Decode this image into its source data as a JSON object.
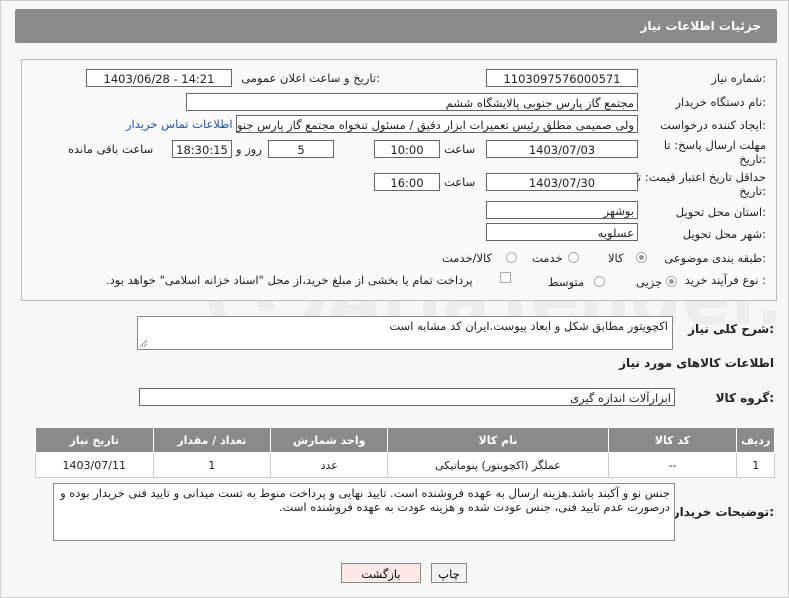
{
  "header": {
    "title": "جزئیات اطلاعات نیاز"
  },
  "form": {
    "need_number_label": "شماره نیاز:",
    "need_number": "1103097576000571",
    "announce_label": "تاریخ و ساعت اعلان عمومی:",
    "announce_value": "1403/06/28 - 14:21",
    "buyer_org_label": "نام دستگاه خریدار:",
    "buyer_org": "مجتمع گاز پارس جنوبی  پالایشگاه ششم",
    "requester_label": "ایجاد کننده درخواست:",
    "requester": "ولی صمیمی مطلق رئیس تعمیرات ابزار دقیق / مسئول تنخواه مجتمع گاز پارس جنوبی",
    "contact_link": "اطلاعات تماس خریدار",
    "deadline_label_1": "مهلت ارسال پاسخ: تا",
    "deadline_label_2": "تاریخ:",
    "deadline_date": "1403/07/03",
    "time_label": "ساعت",
    "deadline_time": "10:00",
    "days_value": "5",
    "days_label": "روز و",
    "remaining_time": "18:30:15",
    "remaining_label": "ساعت باقی مانده",
    "price_label_1": "حداقل تاریخ اعتبار قیمت: تا",
    "price_label_2": "تاریخ:",
    "price_date": "1403/07/30",
    "price_time_label": "ساعت",
    "price_time": "16:00",
    "province_label": "استان محل تحویل:",
    "province": "بوشهر",
    "city_label": "شهر محل تحویل:",
    "city": "عسلویه",
    "category_label": "طبقه بندی موضوعی:",
    "category_goods": "کالا",
    "category_service": "خدمت",
    "category_both": "کالا/خدمت",
    "process_label": "نوع فرآیند خرید :",
    "process_partial": "جزیی",
    "process_medium": "متوسط",
    "payment_note": "پرداخت تمام یا بخشی از مبلغ خرید،از محل \"اسناد خزانه اسلامی\" خواهد بود."
  },
  "description": {
    "label": "شرح کلی نیاز:",
    "text": "اکچویتور مطابق شکل و ابعاد پیوست.ایران کد مشابه است"
  },
  "goods": {
    "section_title": "اطلاعات کالاهای مورد نیاز",
    "group_label": "گروه کالا:",
    "group_value": "ابزارآلات اندازه گیری",
    "columns": [
      "ردیف",
      "کد کالا",
      "نام کالا",
      "واحد شمارش",
      "تعداد / مقدار",
      "تاریخ نیاز"
    ],
    "rows": [
      {
        "row": "1",
        "code": "--",
        "name": "عملگر (اکچویتور) پنوماتیکی",
        "unit": "عدد",
        "qty": "1",
        "date": "1403/07/11"
      }
    ]
  },
  "buyer_notes": {
    "label": "توضیحات خریدار:",
    "line1": "جنس نو و آکبند باشد.هزینه ارسال به عهده فروشنده است. تایید نهایی و پرداخت منوط به تست میدانی و تایید فنی خریدار بوده و",
    "line2": "درصورت عدم تایید فنی، جنس عودت شده و هزینه عودت به عهده فروشنده است."
  },
  "buttons": {
    "print": "چاپ",
    "back": "بازگشت"
  },
  "watermark": {
    "text": "AriaTender.net"
  }
}
